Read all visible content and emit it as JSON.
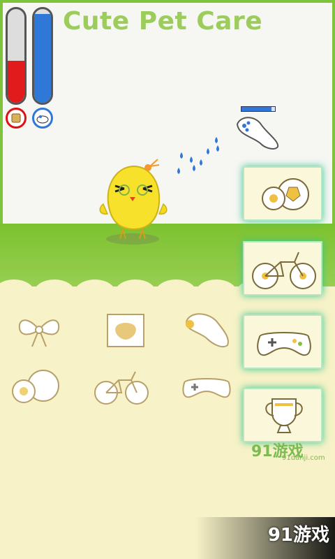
{
  "app": {
    "title": "Cute Pet Care"
  },
  "status": {
    "hunger_level": 0.45,
    "clean_level": 0.95,
    "energy_level": 0.9,
    "meter_icons": [
      {
        "name": "food-icon",
        "color": "#e11b1b"
      },
      {
        "name": "soap-icon",
        "color": "#2f78d8"
      }
    ]
  },
  "colors": {
    "accent_green": "#7fc33c",
    "title_green": "#9ccd5c",
    "meter_red": "#e11b1b",
    "meter_blue": "#2f78d8",
    "glow": "#34c78e"
  },
  "side_buttons": [
    {
      "name": "ball-toy-button"
    },
    {
      "name": "bike-toy-button"
    },
    {
      "name": "gamepad-toy-button"
    },
    {
      "name": "trophy-toy-button"
    }
  ],
  "items_grid": [
    {
      "name": "bow-item"
    },
    {
      "name": "food-bag-item"
    },
    {
      "name": "pacifier-item"
    },
    {
      "name": "ball-item"
    },
    {
      "name": "bike-item"
    },
    {
      "name": "gamepad-item"
    }
  ],
  "watermark": {
    "text": "91游戏",
    "site": "91danji.com"
  }
}
